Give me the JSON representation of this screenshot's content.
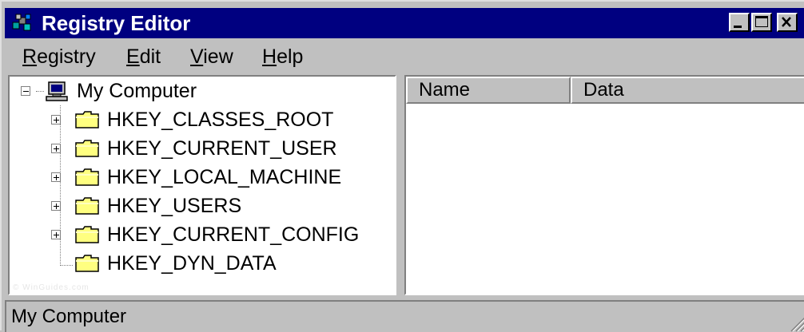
{
  "window": {
    "title": "Registry Editor",
    "icon": "registry-editor-icon",
    "colors": {
      "titlebar": "#000080",
      "face": "#c0c0c0",
      "pane": "#ffffff",
      "folder": "#ffff80"
    }
  },
  "menu": [
    {
      "label": "Registry",
      "mnemonic": "R",
      "rest": "egistry"
    },
    {
      "label": "Edit",
      "mnemonic": "E",
      "rest": "dit"
    },
    {
      "label": "View",
      "mnemonic": "V",
      "rest": "iew"
    },
    {
      "label": "Help",
      "mnemonic": "H",
      "rest": "elp"
    }
  ],
  "tree": {
    "root": {
      "label": "My Computer",
      "icon": "computer-icon",
      "expanded": true
    },
    "keys": [
      {
        "label": "HKEY_CLASSES_ROOT",
        "expandable": true
      },
      {
        "label": "HKEY_CURRENT_USER",
        "expandable": true
      },
      {
        "label": "HKEY_LOCAL_MACHINE",
        "expandable": true
      },
      {
        "label": "HKEY_USERS",
        "expandable": true
      },
      {
        "label": "HKEY_CURRENT_CONFIG",
        "expandable": true
      },
      {
        "label": "HKEY_DYN_DATA",
        "expandable": false
      }
    ],
    "watermark": "© WinGuides.com"
  },
  "list": {
    "columns": [
      "Name",
      "Data"
    ]
  },
  "status": {
    "text": "My Computer"
  }
}
